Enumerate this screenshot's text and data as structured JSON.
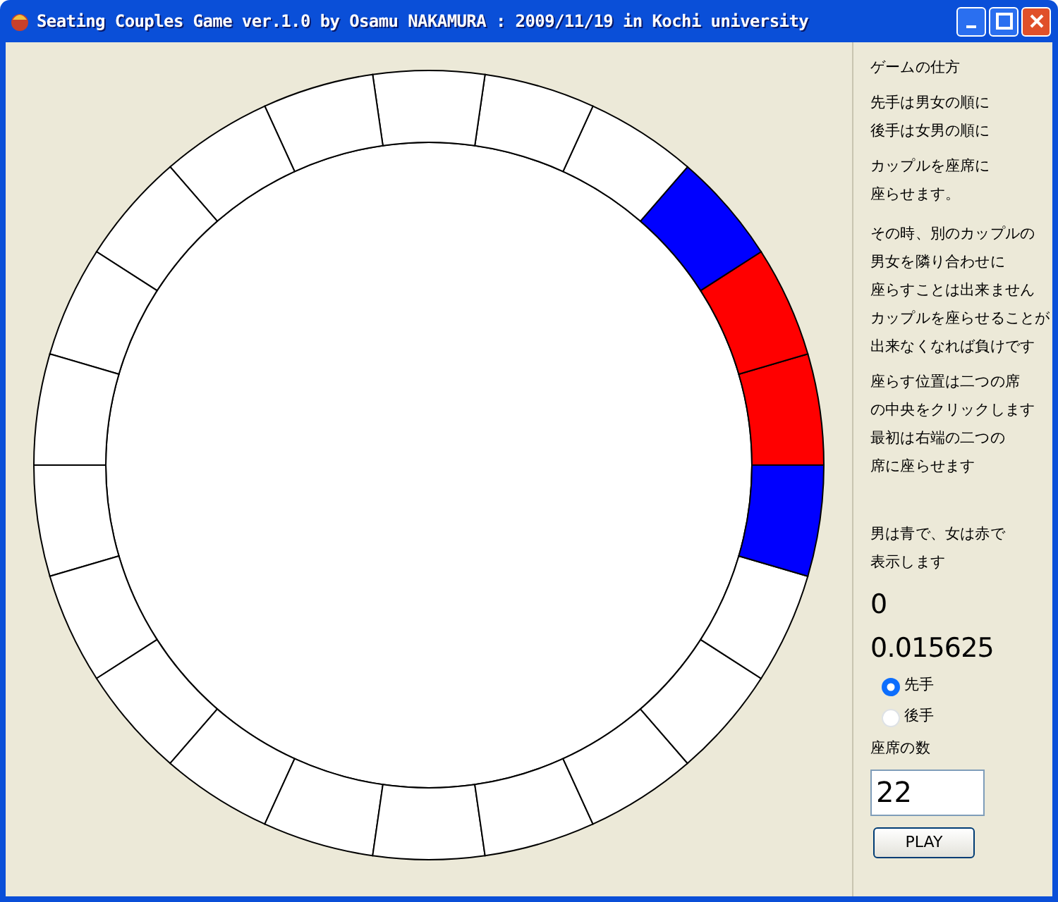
{
  "window": {
    "title": "Seating Couples Game  ver.1.0 by Osamu NAKAMURA  : 2009/11/19 in  Kochi university"
  },
  "seats": [
    {
      "color": "#ff0000"
    },
    {
      "color": "#ff0000"
    },
    {
      "color": "#0000ff"
    },
    {
      "color": "#ffffff"
    },
    {
      "color": "#ffffff"
    },
    {
      "color": "#ffffff"
    },
    {
      "color": "#ffffff"
    },
    {
      "color": "#ffffff"
    },
    {
      "color": "#ffffff"
    },
    {
      "color": "#ffffff"
    },
    {
      "color": "#ffffff"
    },
    {
      "color": "#ffffff"
    },
    {
      "color": "#ffffff"
    },
    {
      "color": "#ffffff"
    },
    {
      "color": "#ffffff"
    },
    {
      "color": "#ffffff"
    },
    {
      "color": "#ffffff"
    },
    {
      "color": "#ffffff"
    },
    {
      "color": "#ffffff"
    },
    {
      "color": "#ffffff"
    },
    {
      "color": "#ffffff"
    },
    {
      "color": "#0000ff"
    }
  ],
  "instructions": [
    {
      "lines": [
        "ゲームの仕方"
      ]
    },
    {
      "lines": [
        "先手は男女の順に",
        "後手は女男の順に"
      ]
    },
    {
      "lines": [
        "カップルを座席に",
        "座らせます。"
      ]
    },
    {
      "lines": [
        "その時、別のカップルの",
        "男女を隣り合わせに",
        "座らすことは出来ません",
        "カップルを座らせることが",
        "出来なくなれば負けです"
      ]
    },
    {
      "lines": [
        "座らす位置は二つの席",
        "の中央をクリックします",
        "最初は右端の二つの",
        "席に座らせます"
      ]
    },
    {
      "lines": [
        "男は青で、女は赤で",
        "表示します"
      ]
    }
  ],
  "readouts": [
    "0",
    "0.015625"
  ],
  "turn_options": [
    {
      "label": "先手",
      "selected": true
    },
    {
      "label": "後手",
      "selected": false
    }
  ],
  "seat_count": {
    "label": "座席の数",
    "value": "22"
  },
  "play_button": "PLAY"
}
